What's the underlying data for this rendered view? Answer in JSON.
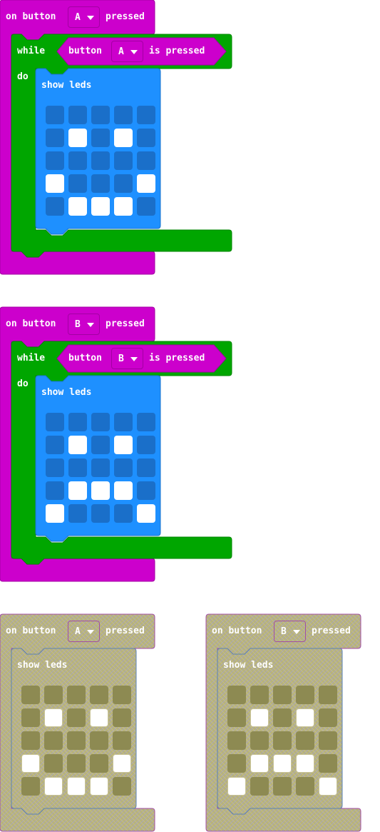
{
  "blocks": [
    {
      "event_prefix": "on button",
      "button": "A",
      "event_suffix": "pressed",
      "while_label": "while",
      "cond_prefix": "button",
      "cond_button": "A",
      "cond_suffix": "is pressed",
      "do_label": "do",
      "show_leds_label": "show leds",
      "leds": [
        [
          0,
          0,
          0,
          0,
          0
        ],
        [
          0,
          1,
          0,
          1,
          0
        ],
        [
          0,
          0,
          0,
          0,
          0
        ],
        [
          1,
          0,
          0,
          0,
          1
        ],
        [
          0,
          1,
          1,
          1,
          0
        ]
      ]
    },
    {
      "event_prefix": "on button",
      "button": "B",
      "event_suffix": "pressed",
      "while_label": "while",
      "cond_prefix": "button",
      "cond_button": "B",
      "cond_suffix": "is pressed",
      "do_label": "do",
      "show_leds_label": "show leds",
      "leds": [
        [
          0,
          0,
          0,
          0,
          0
        ],
        [
          0,
          1,
          0,
          1,
          0
        ],
        [
          0,
          0,
          0,
          0,
          0
        ],
        [
          0,
          1,
          1,
          1,
          0
        ],
        [
          1,
          0,
          0,
          0,
          1
        ]
      ]
    },
    {
      "event_prefix": "on button",
      "button": "A",
      "event_suffix": "pressed",
      "show_leds_label": "show leds",
      "leds": [
        [
          0,
          0,
          0,
          0,
          0
        ],
        [
          0,
          1,
          0,
          1,
          0
        ],
        [
          0,
          0,
          0,
          0,
          0
        ],
        [
          1,
          0,
          0,
          0,
          1
        ],
        [
          0,
          1,
          1,
          1,
          0
        ]
      ]
    },
    {
      "event_prefix": "on button",
      "button": "B",
      "event_suffix": "pressed",
      "show_leds_label": "show leds",
      "leds": [
        [
          0,
          0,
          0,
          0,
          0
        ],
        [
          0,
          1,
          0,
          1,
          0
        ],
        [
          0,
          0,
          0,
          0,
          0
        ],
        [
          0,
          1,
          1,
          1,
          0
        ],
        [
          1,
          0,
          0,
          0,
          1
        ]
      ]
    }
  ],
  "colors": {
    "event": "#cc00cc",
    "event_border": "#a300a3",
    "loop": "#00a600",
    "loop_border": "#008500",
    "basic": "#1e90ff",
    "basic_border": "#1873cc",
    "disabled_fill": "#b9b575",
    "disabled_border_event": "#a34da3",
    "disabled_border_basic": "#5b83b3"
  }
}
